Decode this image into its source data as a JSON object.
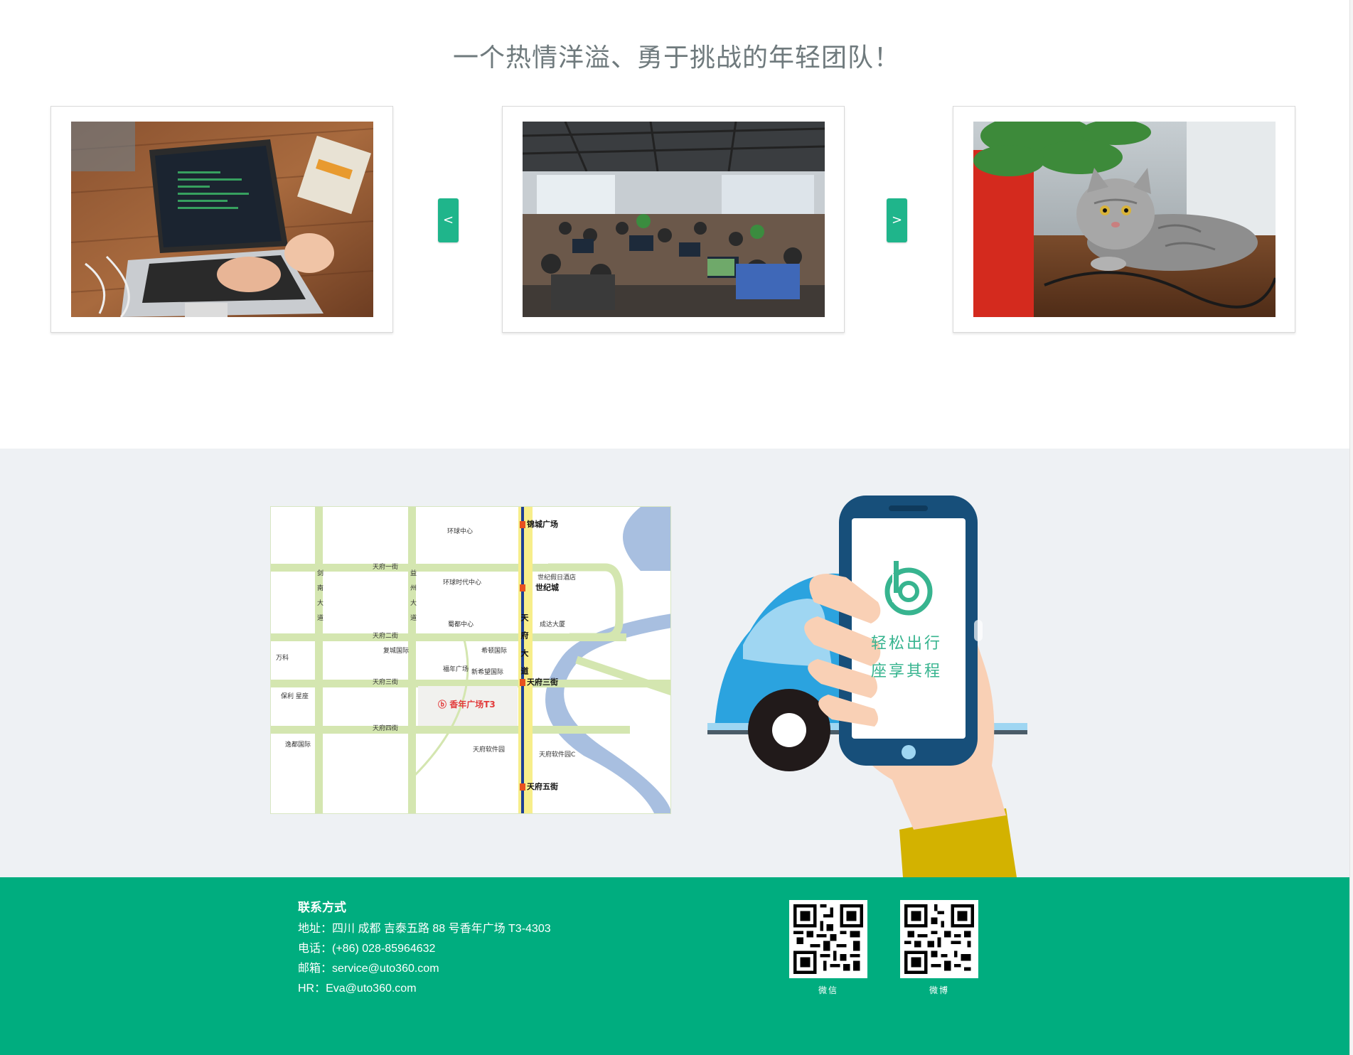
{
  "team": {
    "title": "一个热情洋溢、勇于挑战的年轻团队！",
    "prev_label": "<",
    "next_label": ">",
    "photos": [
      {
        "subject": "laptop-on-desk"
      },
      {
        "subject": "open-office"
      },
      {
        "subject": "cat-on-desk"
      }
    ]
  },
  "map": {
    "labels": {
      "huanqiu": "环球中心",
      "jincheng": "锦城广场",
      "tianfu_1": "天府一街",
      "shiji_hotel": "世纪假日酒店",
      "huanqiu_shidai": "环球时代中心",
      "shijicheng": "世纪城",
      "jiannan": "剑南大道",
      "yizhou": "益州大道",
      "shudu": "蜀都中心",
      "chengda": "成达大厦",
      "tianfu_2": "天府二街",
      "wanke": "万科",
      "fucheng": "复城国际",
      "xidun": "希顿国际",
      "tianfu_avenue": "天府大道",
      "fuchen_square": "福年广场",
      "xinxiwang": "新希望国际",
      "tianfu_3": "天府三街",
      "tianfu_3_metro": "天府三街",
      "baoli": "保利 星座",
      "home": "香年广场T3",
      "tianfu_4": "天府四街",
      "yidu": "逸都国际",
      "software_park": "天府软件园",
      "software_park_c": "天府软件园C",
      "tianfu_5_metro": "天府五街"
    }
  },
  "promo": {
    "line1": "轻松出行",
    "line2": "座享其程"
  },
  "colors": {
    "brand_green": "#00ad7f",
    "arrow_green": "#1fb58b",
    "phone_navy": "#174f7a",
    "car_blue": "#29a3df"
  },
  "footer": {
    "title": "联系方式",
    "address": "地址：四川 成都 吉泰五路 88 号香年广场 T3-4303",
    "phone": "电话：(+86) 028-85964632",
    "email": "邮箱：service@uto360.com",
    "hr": "HR：Eva@uto360.com",
    "qr_weixin_label": "微信",
    "qr_weibo_label": "微博"
  }
}
